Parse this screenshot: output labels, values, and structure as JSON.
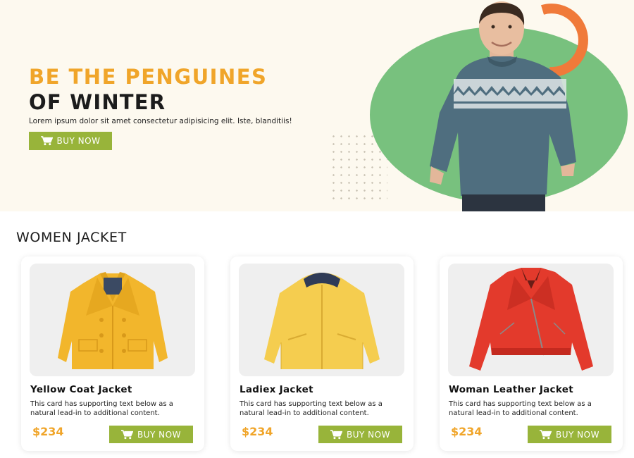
{
  "hero": {
    "title_line1": "BE THE PENGUINES",
    "title_line2": "OF WINTER",
    "subtitle": "Lorem ipsum dolor sit amet consectetur adipisicing elit. Iste, blanditiis!",
    "button_label": "BUY NOW",
    "colors": {
      "background": "#fdf9ef",
      "accent": "#f0a52a",
      "circle": "#78c17e",
      "ring": "#f07a3a",
      "button": "#98b43a"
    }
  },
  "section": {
    "title": "WOMEN JACKET"
  },
  "products": [
    {
      "name": "Yellow Coat Jacket",
      "description": "This card has supporting text below as a natural lead-in to additional content.",
      "price": "$234",
      "button_label": "BUY NOW",
      "image_icon": "yellow-coat-jacket",
      "color": "#f2b62c"
    },
    {
      "name": "Ladiex Jacket",
      "description": "This card has supporting text below as a natural lead-in to additional content.",
      "price": "$234",
      "button_label": "BUY NOW",
      "image_icon": "yellow-hooded-jacket",
      "color": "#f5cd4f"
    },
    {
      "name": "Woman Leather Jacket",
      "description": "This card has supporting text below as a natural lead-in to additional content.",
      "price": "$234",
      "button_label": "BUY NOW",
      "image_icon": "red-leather-jacket",
      "color": "#e33a2c"
    }
  ],
  "icons": {
    "cart": "cart-icon"
  }
}
